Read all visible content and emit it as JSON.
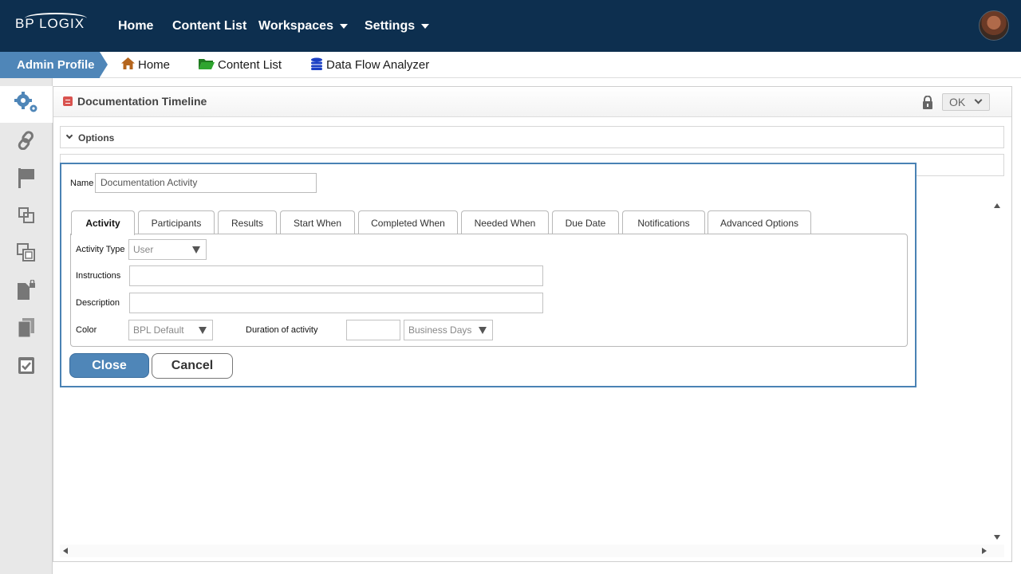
{
  "topbar": {
    "logo": "BP LOGIX",
    "nav": [
      {
        "label": "Home"
      },
      {
        "label": "Content List"
      },
      {
        "label": "Workspaces"
      },
      {
        "label": "Settings"
      }
    ]
  },
  "breadcrumb": {
    "admin": "Admin Profile",
    "items": [
      {
        "label": "Home",
        "icon": "home-icon"
      },
      {
        "label": "Content List",
        "icon": "folder-icon"
      },
      {
        "label": "Data Flow Analyzer",
        "icon": "database-icon"
      }
    ]
  },
  "sidebar": {
    "icons": [
      "gears-icon",
      "link-icon",
      "flag-icon",
      "nested-squares-icon",
      "copy-squares-icon",
      "locked-document-icon",
      "documents-icon",
      "checked-document-icon"
    ]
  },
  "panel": {
    "title": "Documentation Timeline",
    "ok_label": "OK",
    "options_label": "Options"
  },
  "dialog": {
    "name_label": "Name",
    "name_value": "Documentation Activity",
    "tabs": [
      {
        "label": "Activity",
        "active": true
      },
      {
        "label": "Participants"
      },
      {
        "label": "Results"
      },
      {
        "label": "Start When"
      },
      {
        "label": "Completed When"
      },
      {
        "label": "Needed When"
      },
      {
        "label": "Due Date"
      },
      {
        "label": "Notifications"
      },
      {
        "label": "Advanced Options"
      }
    ],
    "fields": {
      "activity_type_label": "Activity Type",
      "activity_type_value": "User",
      "instructions_label": "Instructions",
      "description_label": "Description",
      "color_label": "Color",
      "color_value": "BPL Default",
      "duration_label": "Duration of activity",
      "duration_unit_value": "Business Days"
    },
    "close_label": "Close",
    "cancel_label": "Cancel"
  },
  "colors": {
    "topbar": "#0d2f4f",
    "accent": "#4f86b8"
  }
}
